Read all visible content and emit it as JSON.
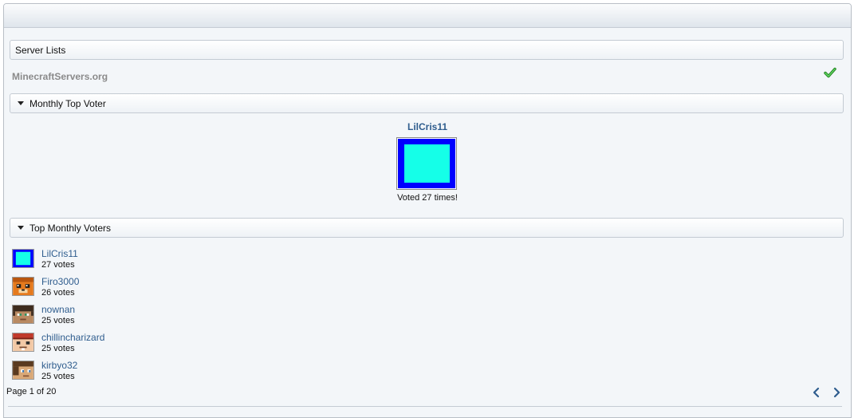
{
  "server_lists": {
    "title": "Server Lists"
  },
  "site": {
    "name": "MinecraftServers.org",
    "status_icon": "checkmark-icon",
    "status_color": "#2aa52a"
  },
  "monthly_top_voter": {
    "title": "Monthly Top Voter",
    "name": "LilCris11",
    "voted_text": "Voted 27 times!"
  },
  "top_monthly_voters": {
    "title": "Top Monthly Voters",
    "voters": [
      {
        "name": "LilCris11",
        "votes": "27 votes"
      },
      {
        "name": "Firo3000",
        "votes": "26 votes"
      },
      {
        "name": "nownan",
        "votes": "25 votes"
      },
      {
        "name": "chillincharizard",
        "votes": "25 votes"
      },
      {
        "name": "kirbyo32",
        "votes": "25 votes"
      }
    ]
  },
  "pagination": {
    "text": "Page 1 of 20",
    "prev_icon": "chevron-left-icon",
    "next_icon": "chevron-right-icon"
  },
  "colors": {
    "link": "#2f5d8e",
    "accent_blue": "#0000ff",
    "accent_cyan": "#15ffe8"
  }
}
